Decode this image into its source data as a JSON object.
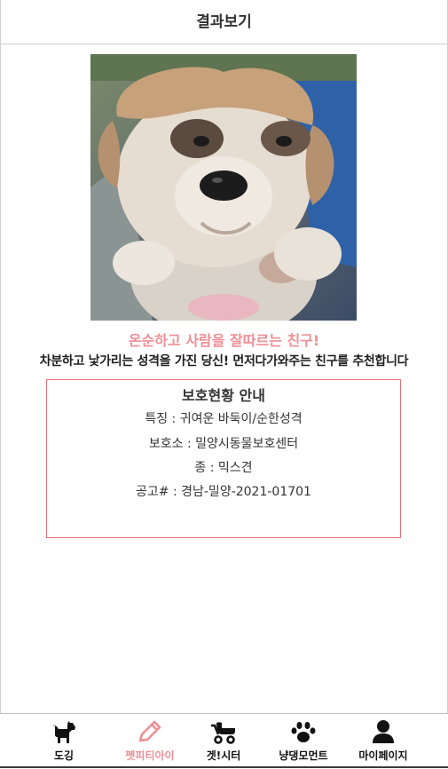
{
  "header": {
    "title": "결과보기"
  },
  "result": {
    "photo_alt": "강아지 사진",
    "headline": "온순하고 사람을 잘따르는 친구!",
    "description": "차분하고 낯가리는 성격을 가진 당신! 먼저다가와주는 친구를 추천합니다"
  },
  "info": {
    "title": "보호현황 안내",
    "feature": "특징 : 귀여운 바둑이/순한성격",
    "shelter": "보호소 : 밀양시동물보호센터",
    "breed": "종 : 믹스견",
    "notice": "공고# : 경남-밀양-2021-01701"
  },
  "tabs": [
    {
      "label": "도깅",
      "icon": "dog-icon"
    },
    {
      "label": "펫피티아이",
      "icon": "pencil-icon",
      "active": true
    },
    {
      "label": "겟!시터",
      "icon": "stroller-icon"
    },
    {
      "label": "냥댕모먼트",
      "icon": "paw-icon"
    },
    {
      "label": "마이페이지",
      "icon": "user-icon"
    }
  ],
  "colors": {
    "accent": "#ee8f95",
    "box_border": "#e5737a"
  }
}
